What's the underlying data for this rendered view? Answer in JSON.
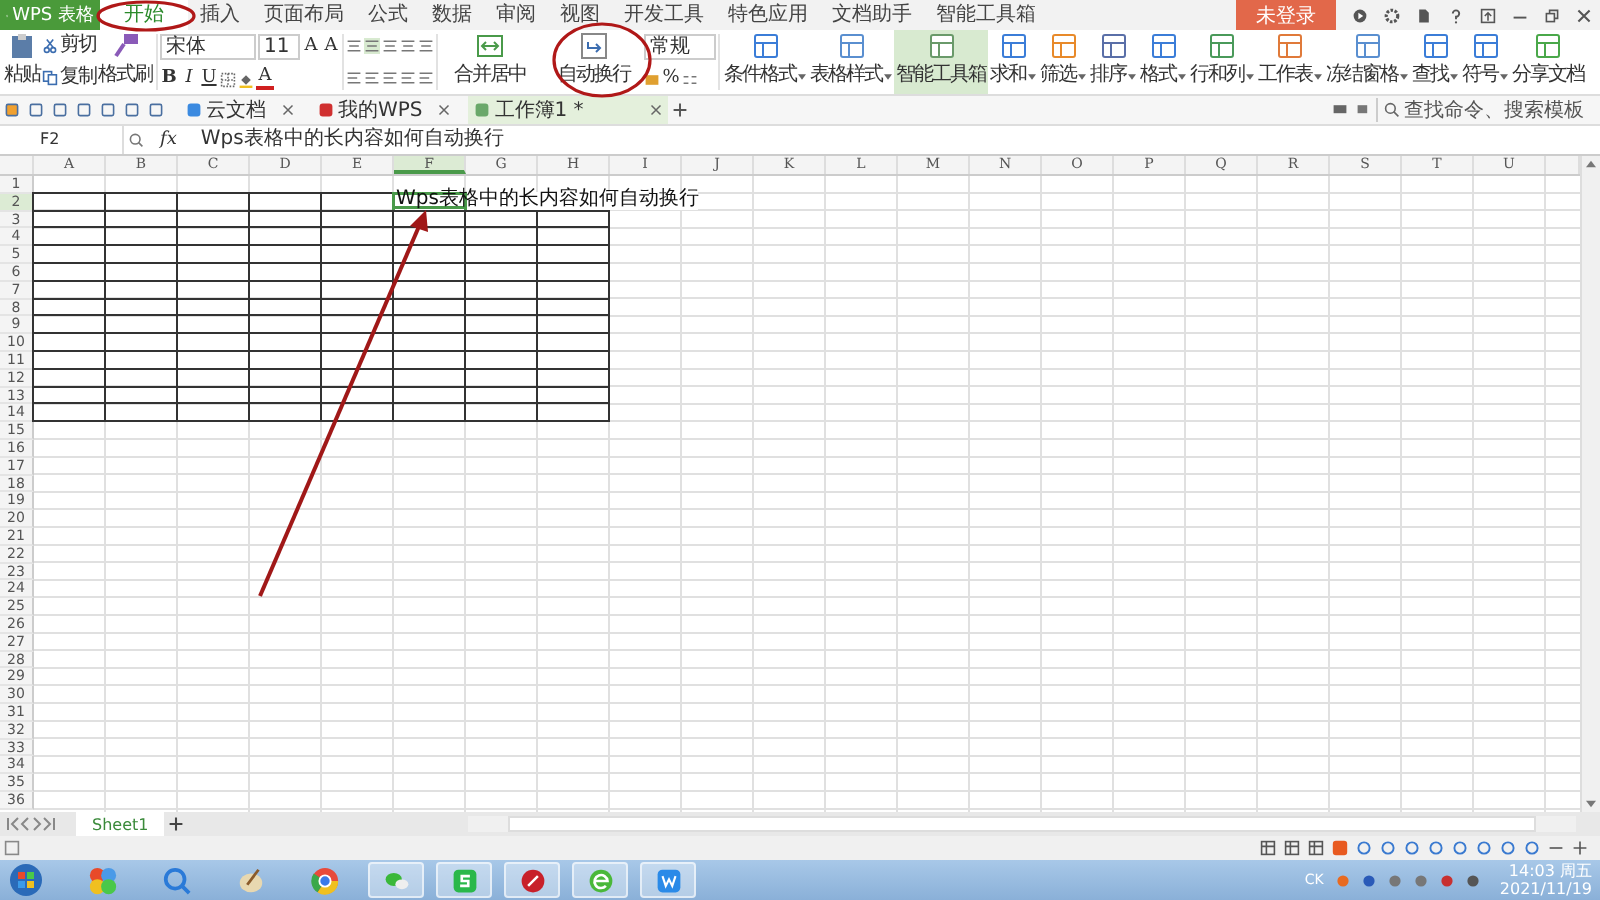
{
  "app_name": "WPS 表格",
  "menu_tabs": [
    {
      "label": "开始",
      "selected": true
    },
    {
      "label": "插入",
      "selected": false
    },
    {
      "label": "页面布局",
      "selected": false
    },
    {
      "label": "公式",
      "selected": false
    },
    {
      "label": "数据",
      "selected": false
    },
    {
      "label": "审阅",
      "selected": false
    },
    {
      "label": "视图",
      "selected": false
    },
    {
      "label": "开发工具",
      "selected": false
    },
    {
      "label": "特色应用",
      "selected": false
    },
    {
      "label": "文档助手",
      "selected": false
    },
    {
      "label": "智能工具箱",
      "selected": false
    }
  ],
  "login": "未登录",
  "ribbon": {
    "paste": "粘贴",
    "cut": "剪切",
    "copy": "复制",
    "format_painter": "格式刷",
    "font_name": "宋体",
    "font_size": "11",
    "size_buttons": [
      "A",
      "A"
    ],
    "styles": [
      "B",
      "I",
      "U"
    ],
    "color_letter": "A",
    "merge": "合并居中",
    "wrap": "自动换行",
    "number_format": "常规",
    "percent": "%",
    "tools": [
      {
        "label": "条件格式",
        "dropdown": true,
        "selected": false
      },
      {
        "label": "表格样式",
        "dropdown": true,
        "selected": false
      },
      {
        "label": "智能工具箱",
        "dropdown": false,
        "selected": true
      },
      {
        "label": "求和",
        "dropdown": true,
        "selected": false
      },
      {
        "label": "筛选",
        "dropdown": true,
        "selected": false
      },
      {
        "label": "排序",
        "dropdown": true,
        "selected": false
      },
      {
        "label": "格式",
        "dropdown": true,
        "selected": false
      },
      {
        "label": "行和列",
        "dropdown": true,
        "selected": false
      },
      {
        "label": "工作表",
        "dropdown": true,
        "selected": false
      },
      {
        "label": "冻结窗格",
        "dropdown": true,
        "selected": false
      },
      {
        "label": "查找",
        "dropdown": true,
        "selected": false
      },
      {
        "label": "符号",
        "dropdown": true,
        "selected": false
      },
      {
        "label": "分享文档",
        "dropdown": false,
        "selected": false
      }
    ]
  },
  "doc_tabs": [
    {
      "label": "云文档",
      "selected": false
    },
    {
      "label": "我的WPS",
      "selected": false
    },
    {
      "label": "工作簿1 *",
      "selected": true
    }
  ],
  "search": {
    "placeholder": "查找命令、搜索模板"
  },
  "name_box": "F2",
  "fx": "fx",
  "formula": "Wps表格中的长内容如何自动换行",
  "columns": [
    {
      "label": "A",
      "selected": false,
      "bordered": true
    },
    {
      "label": "B",
      "selected": false,
      "bordered": true
    },
    {
      "label": "C",
      "selected": false,
      "bordered": true
    },
    {
      "label": "D",
      "selected": false,
      "bordered": true
    },
    {
      "label": "E",
      "selected": false,
      "bordered": true
    },
    {
      "label": "F",
      "selected": true,
      "bordered": true
    },
    {
      "label": "G",
      "selected": false,
      "bordered": true
    },
    {
      "label": "H",
      "selected": false,
      "bordered": true
    },
    {
      "label": "I",
      "selected": false,
      "bordered": false
    },
    {
      "label": "J",
      "selected": false,
      "bordered": false
    },
    {
      "label": "K",
      "selected": false,
      "bordered": false
    },
    {
      "label": "L",
      "selected": false,
      "bordered": false
    },
    {
      "label": "M",
      "selected": false,
      "bordered": false
    },
    {
      "label": "N",
      "selected": false,
      "bordered": false
    },
    {
      "label": "O",
      "selected": false,
      "bordered": false
    },
    {
      "label": "P",
      "selected": false,
      "bordered": false
    },
    {
      "label": "Q",
      "selected": false,
      "bordered": false
    },
    {
      "label": "R",
      "selected": false,
      "bordered": false
    },
    {
      "label": "S",
      "selected": false,
      "bordered": false
    },
    {
      "label": "T",
      "selected": false,
      "bordered": false
    },
    {
      "label": "U",
      "selected": false,
      "bordered": false
    }
  ],
  "rows": [
    {
      "label": "1",
      "selected": false,
      "bordered": false
    },
    {
      "label": "2",
      "selected": true,
      "bordered": true
    },
    {
      "label": "3",
      "selected": false,
      "bordered": true
    },
    {
      "label": "4",
      "selected": false,
      "bordered": true
    },
    {
      "label": "5",
      "selected": false,
      "bordered": true
    },
    {
      "label": "6",
      "selected": false,
      "bordered": true
    },
    {
      "label": "7",
      "selected": false,
      "bordered": true
    },
    {
      "label": "8",
      "selected": false,
      "bordered": true
    },
    {
      "label": "9",
      "selected": false,
      "bordered": true
    },
    {
      "label": "10",
      "selected": false,
      "bordered": true
    },
    {
      "label": "11",
      "selected": false,
      "bordered": true
    },
    {
      "label": "12",
      "selected": false,
      "bordered": true
    },
    {
      "label": "13",
      "selected": false,
      "bordered": true
    },
    {
      "label": "14",
      "selected": false,
      "bordered": true
    },
    {
      "label": "15",
      "selected": false,
      "bordered": false
    },
    {
      "label": "16",
      "selected": false,
      "bordered": false
    },
    {
      "label": "17",
      "selected": false,
      "bordered": false
    },
    {
      "label": "18",
      "selected": false,
      "bordered": false
    },
    {
      "label": "19",
      "selected": false,
      "bordered": false
    },
    {
      "label": "20",
      "selected": false,
      "bordered": false
    },
    {
      "label": "21",
      "selected": false,
      "bordered": false
    },
    {
      "label": "22",
      "selected": false,
      "bordered": false
    },
    {
      "label": "23",
      "selected": false,
      "bordered": false
    },
    {
      "label": "24",
      "selected": false,
      "bordered": false
    },
    {
      "label": "25",
      "selected": false,
      "bordered": false
    },
    {
      "label": "26",
      "selected": false,
      "bordered": false
    },
    {
      "label": "27",
      "selected": false,
      "bordered": false
    },
    {
      "label": "28",
      "selected": false,
      "bordered": false
    },
    {
      "label": "29",
      "selected": false,
      "bordered": false
    },
    {
      "label": "30",
      "selected": false,
      "bordered": false
    },
    {
      "label": "31",
      "selected": false,
      "bordered": false
    },
    {
      "label": "32",
      "selected": false,
      "bordered": false
    },
    {
      "label": "33",
      "selected": false,
      "bordered": false
    },
    {
      "label": "34",
      "selected": false,
      "bordered": false
    },
    {
      "label": "35",
      "selected": false,
      "bordered": false
    },
    {
      "label": "36",
      "selected": false,
      "bordered": false
    }
  ],
  "active_cell": {
    "text": "Wps表格中的长内容如何自动换行"
  },
  "sheet_tabs": [
    {
      "label": "Sheet1",
      "selected": true
    }
  ],
  "taskbar": {
    "tray_label": "CK",
    "time": "14:03 周五",
    "date": "2021/11/19"
  }
}
